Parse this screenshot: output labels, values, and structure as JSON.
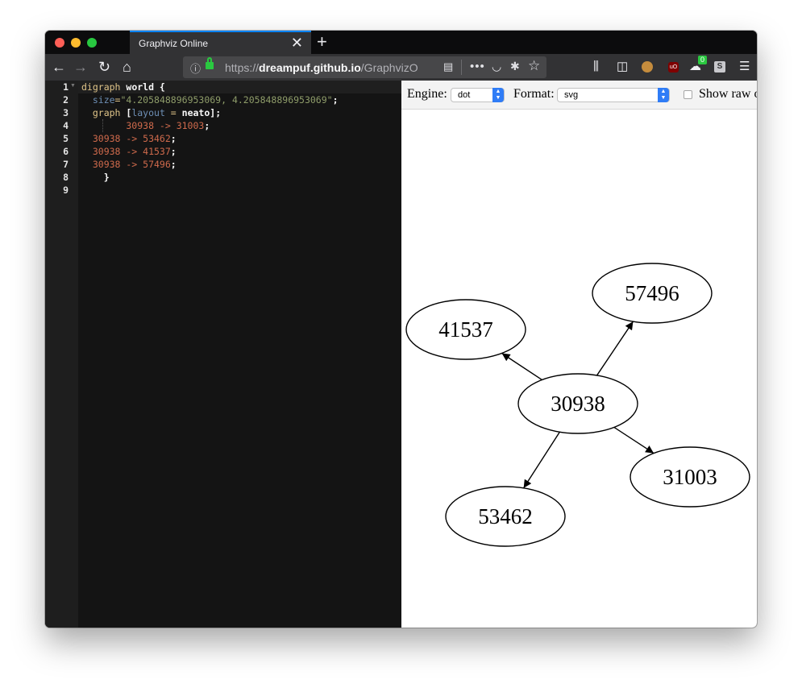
{
  "browser": {
    "tab_title": "Graphviz Online",
    "tab_close": "✕",
    "new_tab": "+",
    "url_prefix": "https://",
    "url_host": "dreampuf.github.io",
    "url_path": "/GraphvizOnline/",
    "badge_count": "0",
    "icons": [
      "back-icon",
      "forward-icon",
      "reload-icon",
      "home-icon",
      "info-icon",
      "lock-icon",
      "reader-icon",
      "more-icon",
      "pocket-icon",
      "bug-icon",
      "bookmark-star-icon",
      "library-icon",
      "sidebar-icon",
      "monkey-icon",
      "ublock-icon",
      "extension-icon",
      "s-icon",
      "menu-icon"
    ]
  },
  "editor": {
    "line_numbers": [
      "1",
      "2",
      "3",
      "4",
      "5",
      "6",
      "7",
      "8",
      "9"
    ],
    "lines": [
      [
        {
          "t": "digraph",
          "c": "kw"
        },
        {
          "t": " world {",
          "c": "wht"
        }
      ],
      [
        {
          "t": "  size",
          "c": "attr"
        },
        {
          "t": "=",
          "c": "op"
        },
        {
          "t": "\"4.205848896953069, 4.205848896953069\"",
          "c": "str"
        },
        {
          "t": ";",
          "c": "wht"
        }
      ],
      [
        {
          "t": "  graph",
          "c": "kw"
        },
        {
          "t": " [",
          "c": "wht"
        },
        {
          "t": "layout",
          "c": "attr"
        },
        {
          "t": " = ",
          "c": "op"
        },
        {
          "t": "neato",
          "c": "wht"
        },
        {
          "t": "];",
          "c": "wht"
        }
      ],
      [
        {
          "t": "        30938 -> 31003",
          "c": "num"
        },
        {
          "t": ";",
          "c": "wht"
        }
      ],
      [
        {
          "t": "  30938 -> 53462",
          "c": "num"
        },
        {
          "t": ";",
          "c": "wht"
        }
      ],
      [
        {
          "t": "  30938 -> 41537",
          "c": "num"
        },
        {
          "t": ";",
          "c": "wht"
        }
      ],
      [
        {
          "t": "  30938 -> 57496",
          "c": "num"
        },
        {
          "t": ";",
          "c": "wht"
        }
      ],
      [
        {
          "t": "    }",
          "c": "wht"
        }
      ],
      [
        {
          "t": "",
          "c": "wht"
        }
      ]
    ]
  },
  "controls": {
    "engine_label": "Engine:",
    "engine_value": "dot",
    "format_label": "Format:",
    "format_value": "svg",
    "show_raw_label": "Show raw o"
  },
  "graph": {
    "nodes": [
      {
        "id": "30938",
        "label": "30938"
      },
      {
        "id": "57496",
        "label": "57496"
      },
      {
        "id": "41537",
        "label": "41537"
      },
      {
        "id": "31003",
        "label": "31003"
      },
      {
        "id": "53462",
        "label": "53462"
      }
    ],
    "edges": [
      {
        "from": "30938",
        "to": "31003"
      },
      {
        "from": "30938",
        "to": "53462"
      },
      {
        "from": "30938",
        "to": "41537"
      },
      {
        "from": "30938",
        "to": "57496"
      }
    ]
  }
}
